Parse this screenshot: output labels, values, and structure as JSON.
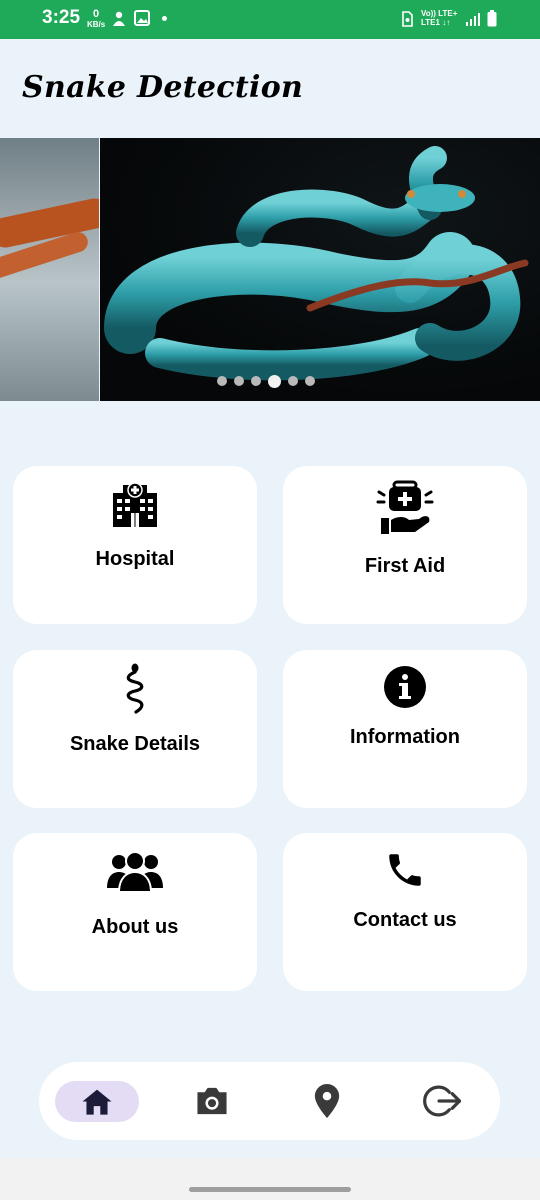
{
  "status_bar": {
    "time": "3:25",
    "speed_value": "0",
    "speed_unit": "KB/s",
    "network_line1": "Vo)) LTE+",
    "network_line2": "LTE1 ↓↑"
  },
  "app": {
    "title": "Snake Detection"
  },
  "carousel": {
    "slide_count": 6,
    "active_index": 3
  },
  "cards": {
    "hospital": {
      "label": "Hospital",
      "icon": "hospital-icon"
    },
    "first_aid": {
      "label": "First Aid",
      "icon": "first-aid-kit-icon"
    },
    "snake_details": {
      "label": "Snake Details",
      "icon": "snake-icon"
    },
    "information": {
      "label": "Information",
      "icon": "info-icon"
    },
    "about_us": {
      "label": "About us",
      "icon": "group-icon"
    },
    "contact_us": {
      "label": "Contact us",
      "icon": "phone-icon"
    }
  },
  "bottom_nav": {
    "items": [
      "home-icon",
      "camera-icon",
      "location-pin-icon",
      "logout-icon"
    ],
    "active": "home-icon"
  },
  "colors": {
    "status_bar": "#1faa59",
    "background": "#e9f3f9",
    "card": "#ffffff",
    "nav_active_pill": "#e4dcf4",
    "nav_icon": "#333333"
  }
}
